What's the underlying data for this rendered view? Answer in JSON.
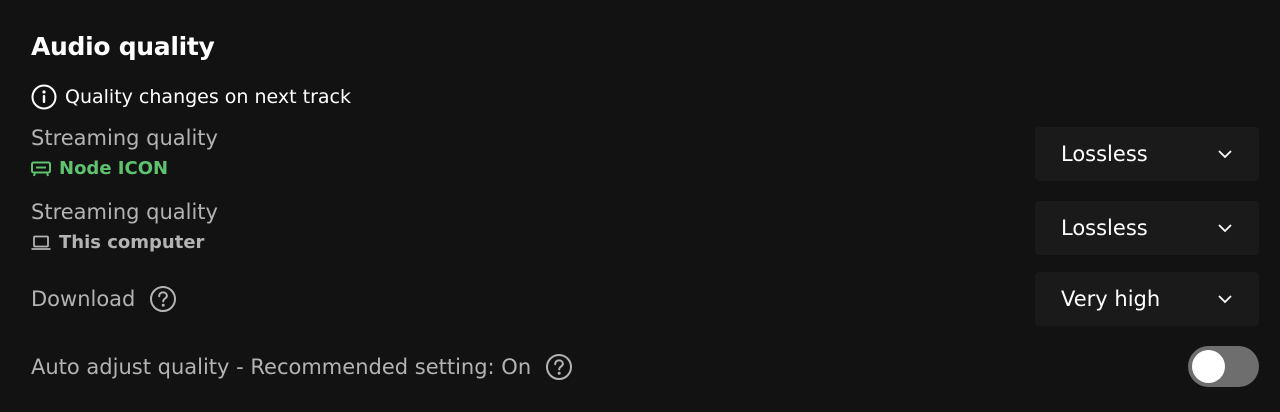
{
  "section": {
    "title": "Audio quality",
    "notice": "Quality changes on next track"
  },
  "settings": [
    {
      "label": "Streaming quality",
      "device": "Node ICON",
      "device_icon": "speaker-device-icon",
      "device_color": "#5ec26f",
      "value": "Lossless"
    },
    {
      "label": "Streaming quality",
      "device": "This computer",
      "device_icon": "laptop-icon",
      "device_color": "#b3b3b3",
      "value": "Lossless"
    },
    {
      "label": "Download",
      "value": "Very high"
    }
  ],
  "auto_adjust": {
    "label": "Auto adjust quality - Recommended setting: On",
    "enabled": false
  },
  "colors": {
    "background": "#121212",
    "text_primary": "#ffffff",
    "text_secondary": "#b3b3b3",
    "active_device": "#5ec26f",
    "dropdown_bg": "#1a1a1a",
    "toggle_off": "#6e6e6e"
  }
}
